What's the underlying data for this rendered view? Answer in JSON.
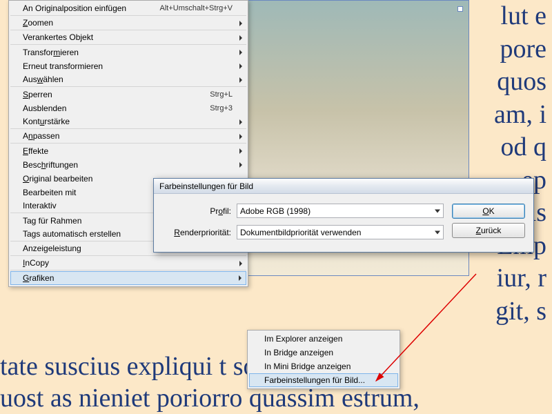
{
  "background_text": "lut e\npore\nquos\nam, i\nod q\nep\nObis\nEmp\niur, r\ngit, s",
  "bg_line_left_1": "tate suscius expliqui t                  solut",
  "bg_line_left_2": "uost as nieniet poriorro quassim estrum,",
  "menu": {
    "items": [
      {
        "label_html": "An Originalposition einfügen",
        "shortcut": "Alt+Umschalt+Strg+V",
        "arrow": false,
        "sep": true
      },
      {
        "label_html": "<u>Z</u>oomen",
        "shortcut": "",
        "arrow": true,
        "sep": true
      },
      {
        "label_html": "Verankertes Objekt",
        "shortcut": "",
        "arrow": true,
        "sep": true
      },
      {
        "label_html": "Transfor<u>m</u>ieren",
        "shortcut": "",
        "arrow": true,
        "sep": false
      },
      {
        "label_html": "Erneut transformieren",
        "shortcut": "",
        "arrow": true,
        "sep": false
      },
      {
        "label_html": "Aus<u>w</u>ählen",
        "shortcut": "",
        "arrow": true,
        "sep": true
      },
      {
        "label_html": "<u>S</u>perren",
        "shortcut": "Strg+L",
        "arrow": false,
        "sep": false
      },
      {
        "label_html": "Ausblenden",
        "shortcut": "Strg+3",
        "arrow": false,
        "sep": false
      },
      {
        "label_html": "Kont<u>u</u>rstärke",
        "shortcut": "",
        "arrow": true,
        "sep": true
      },
      {
        "label_html": "A<u>n</u>passen",
        "shortcut": "",
        "arrow": true,
        "sep": true
      },
      {
        "label_html": "<u>E</u>ffekte",
        "shortcut": "",
        "arrow": true,
        "sep": false
      },
      {
        "label_html": "Besc<u>h</u>riftungen",
        "shortcut": "",
        "arrow": true,
        "sep": false
      },
      {
        "label_html": "<u>O</u>riginal bearbeiten",
        "shortcut": "",
        "arrow": false,
        "sep": false
      },
      {
        "label_html": "Bearbeiten mit",
        "shortcut": "",
        "arrow": true,
        "sep": false
      },
      {
        "label_html": "Interaktiv",
        "shortcut": "",
        "arrow": true,
        "sep": true
      },
      {
        "label_html": "Tag für Rahmen",
        "shortcut": "",
        "arrow": true,
        "sep": false
      },
      {
        "label_html": "Tags automatisch erstellen",
        "shortcut": "",
        "arrow": false,
        "sep": true
      },
      {
        "label_html": "Anzeigeleistung",
        "shortcut": "",
        "arrow": true,
        "sep": true
      },
      {
        "label_html": "<u>I</u>nCopy",
        "shortcut": "",
        "arrow": true,
        "sep": true
      },
      {
        "label_html": "<u>G</u>rafiken",
        "shortcut": "",
        "arrow": true,
        "sep": false,
        "highlight": true
      }
    ]
  },
  "submenu": {
    "items": [
      {
        "label": "Im Explorer anzeigen",
        "highlight": false
      },
      {
        "label": "In Bridge anzeigen",
        "highlight": false
      },
      {
        "label": "In Mini Bridge anzeigen",
        "highlight": false
      },
      {
        "label": "Farbeinstellungen für Bild...",
        "highlight": true
      }
    ]
  },
  "dialog": {
    "title": "Farbeinstellungen für Bild",
    "profile_label_html": "Pr<u>o</u>fil:",
    "profile_value": "Adobe RGB (1998)",
    "render_label_html": "<u>R</u>enderpriorität:",
    "render_value": "Dokumentbildpriorität verwenden",
    "ok_html": "<u>O</u>K",
    "cancel_html": "<u>Z</u>urück"
  }
}
